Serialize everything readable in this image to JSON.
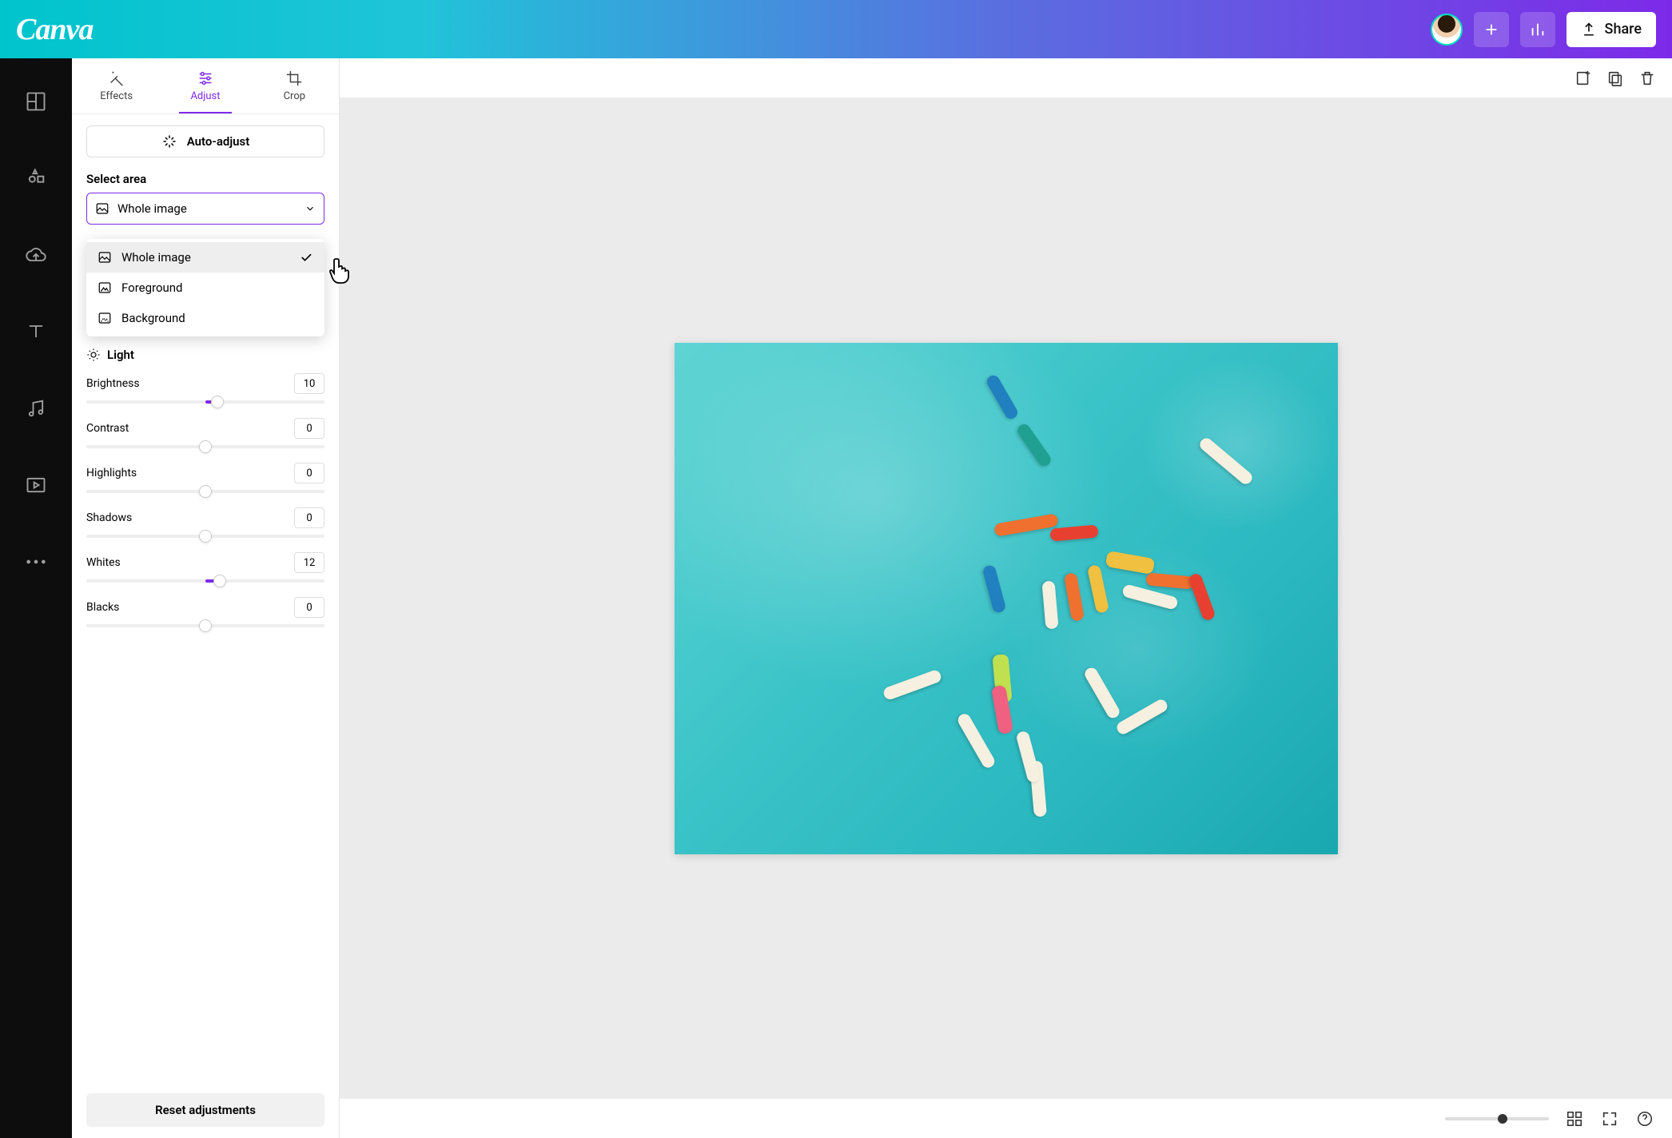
{
  "header": {
    "logo": "Canva",
    "share_label": "Share"
  },
  "rail": {
    "items": [
      "templates",
      "elements",
      "uploads",
      "text",
      "audio",
      "videos",
      "more"
    ]
  },
  "panel": {
    "tabs": {
      "effects": "Effects",
      "adjust": "Adjust",
      "crop": "Crop",
      "active": "adjust"
    },
    "auto_adjust": "Auto-adjust",
    "select_area_label": "Select area",
    "select_area_value": "Whole image",
    "dropdown": {
      "whole_image": "Whole image",
      "foreground": "Foreground",
      "background": "Background",
      "selected": "whole_image"
    },
    "light_group": "Light",
    "sliders": {
      "brightness": {
        "label": "Brightness",
        "value": "10"
      },
      "contrast": {
        "label": "Contrast",
        "value": "0"
      },
      "highlights": {
        "label": "Highlights",
        "value": "0"
      },
      "shadows": {
        "label": "Shadows",
        "value": "0"
      },
      "whites": {
        "label": "Whites",
        "value": "12"
      },
      "blacks": {
        "label": "Blacks",
        "value": "0"
      }
    },
    "reset": "Reset adjustments"
  },
  "colors": {
    "accent": "#7d2ae8",
    "header_gradient_start": "#00c4cc",
    "header_gradient_end": "#7d2ae8"
  }
}
